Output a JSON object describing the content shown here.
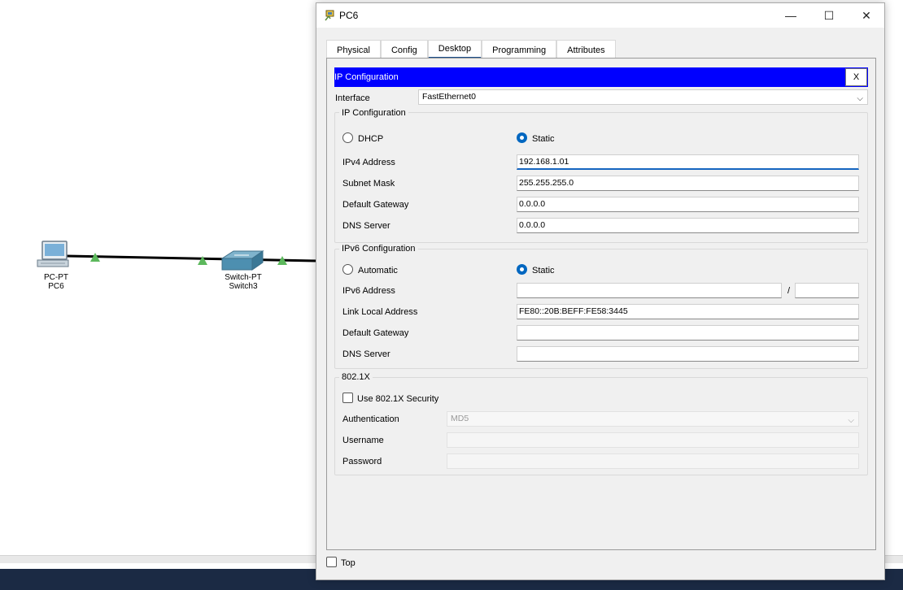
{
  "workspace": {
    "pc": {
      "type": "PC-PT",
      "name": "PC6"
    },
    "switch": {
      "type": "Switch-PT",
      "name": "Switch3"
    }
  },
  "window": {
    "title": "PC6",
    "minimize": "—",
    "maximize": "☐",
    "close": "✕"
  },
  "tabs": [
    {
      "label": "Physical"
    },
    {
      "label": "Config"
    },
    {
      "label": "Desktop"
    },
    {
      "label": "Programming"
    },
    {
      "label": "Attributes"
    }
  ],
  "active_tab": "Desktop",
  "ip_config": {
    "title": "IP Configuration",
    "close": "X",
    "interface_label": "Interface",
    "interface_value": "FastEthernet0",
    "ipv4": {
      "legend": "IP Configuration",
      "dhcp": "DHCP",
      "static": "Static",
      "mode": "Static",
      "address_label": "IPv4 Address",
      "address": "192.168.1.01",
      "mask_label": "Subnet Mask",
      "mask": "255.255.255.0",
      "gateway_label": "Default Gateway",
      "gateway": "0.0.0.0",
      "dns_label": "DNS Server",
      "dns": "0.0.0.0"
    },
    "ipv6": {
      "legend": "IPv6 Configuration",
      "automatic": "Automatic",
      "static": "Static",
      "mode": "Static",
      "address_label": "IPv6 Address",
      "address": "",
      "prefix_sep": "/",
      "prefix": "",
      "link_local_label": "Link Local Address",
      "link_local": "FE80::20B:BEFF:FE58:3445",
      "gateway_label": "Default Gateway",
      "gateway": "",
      "dns_label": "DNS Server",
      "dns": ""
    },
    "dot1x": {
      "legend": "802.1X",
      "use_label": "Use 802.1X Security",
      "auth_label": "Authentication",
      "auth_value": "MD5",
      "username_label": "Username",
      "username": "",
      "password_label": "Password",
      "password": ""
    }
  },
  "footer": {
    "top_label": "Top"
  },
  "colors": {
    "ip_bar": "#0000ff",
    "radio_selected": "#0067c0",
    "active_tab_underline": "#1a4e8a"
  }
}
